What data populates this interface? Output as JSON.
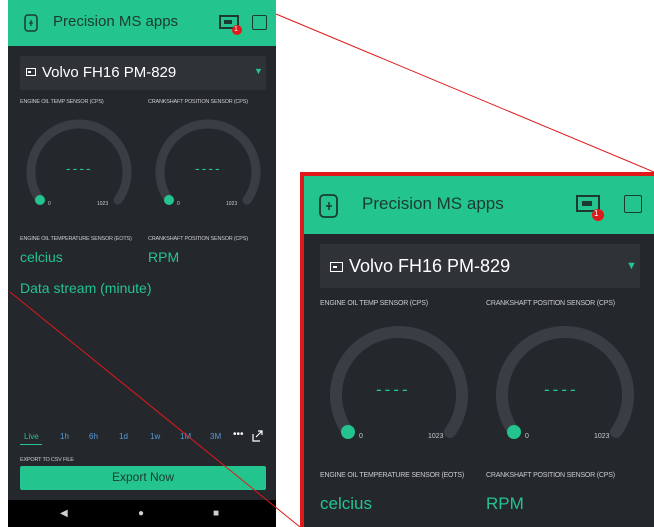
{
  "app": {
    "title": "Precision MS apps",
    "badge": "1",
    "device": "Volvo FH16 PM-829"
  },
  "gauges": [
    {
      "label": "ENGINE OIL TEMP SENSOR (CPS)",
      "value": "----",
      "min": "0",
      "max": "1023"
    },
    {
      "label": "CRANKSHAFT POSITION SENSOR (CPS)",
      "value": "----",
      "min": "0",
      "max": "1023"
    }
  ],
  "values": [
    {
      "label": "ENGINE OIL TEMPERATURE SENSOR (EOTS)",
      "value": "celcius"
    },
    {
      "label": "CRANKSHAFT POSITION SENSOR (CPS)",
      "value": "RPM"
    }
  ],
  "chart": {
    "title": "Data stream (minute)"
  },
  "ranges": [
    "Live",
    "1h",
    "6h",
    "1d",
    "1w",
    "1M",
    "3M"
  ],
  "export": {
    "label": "EXPORT TO CSV FILE",
    "button": "Export Now"
  },
  "colors": {
    "accent": "#23c48e",
    "background": "#24272c",
    "annotation": "#e0191a"
  },
  "icons": [
    "device-icon",
    "battery-icon",
    "square-icon",
    "dropdown-arrow-icon",
    "more-icon",
    "share-icon",
    "back-icon",
    "home-icon",
    "recents-icon"
  ]
}
